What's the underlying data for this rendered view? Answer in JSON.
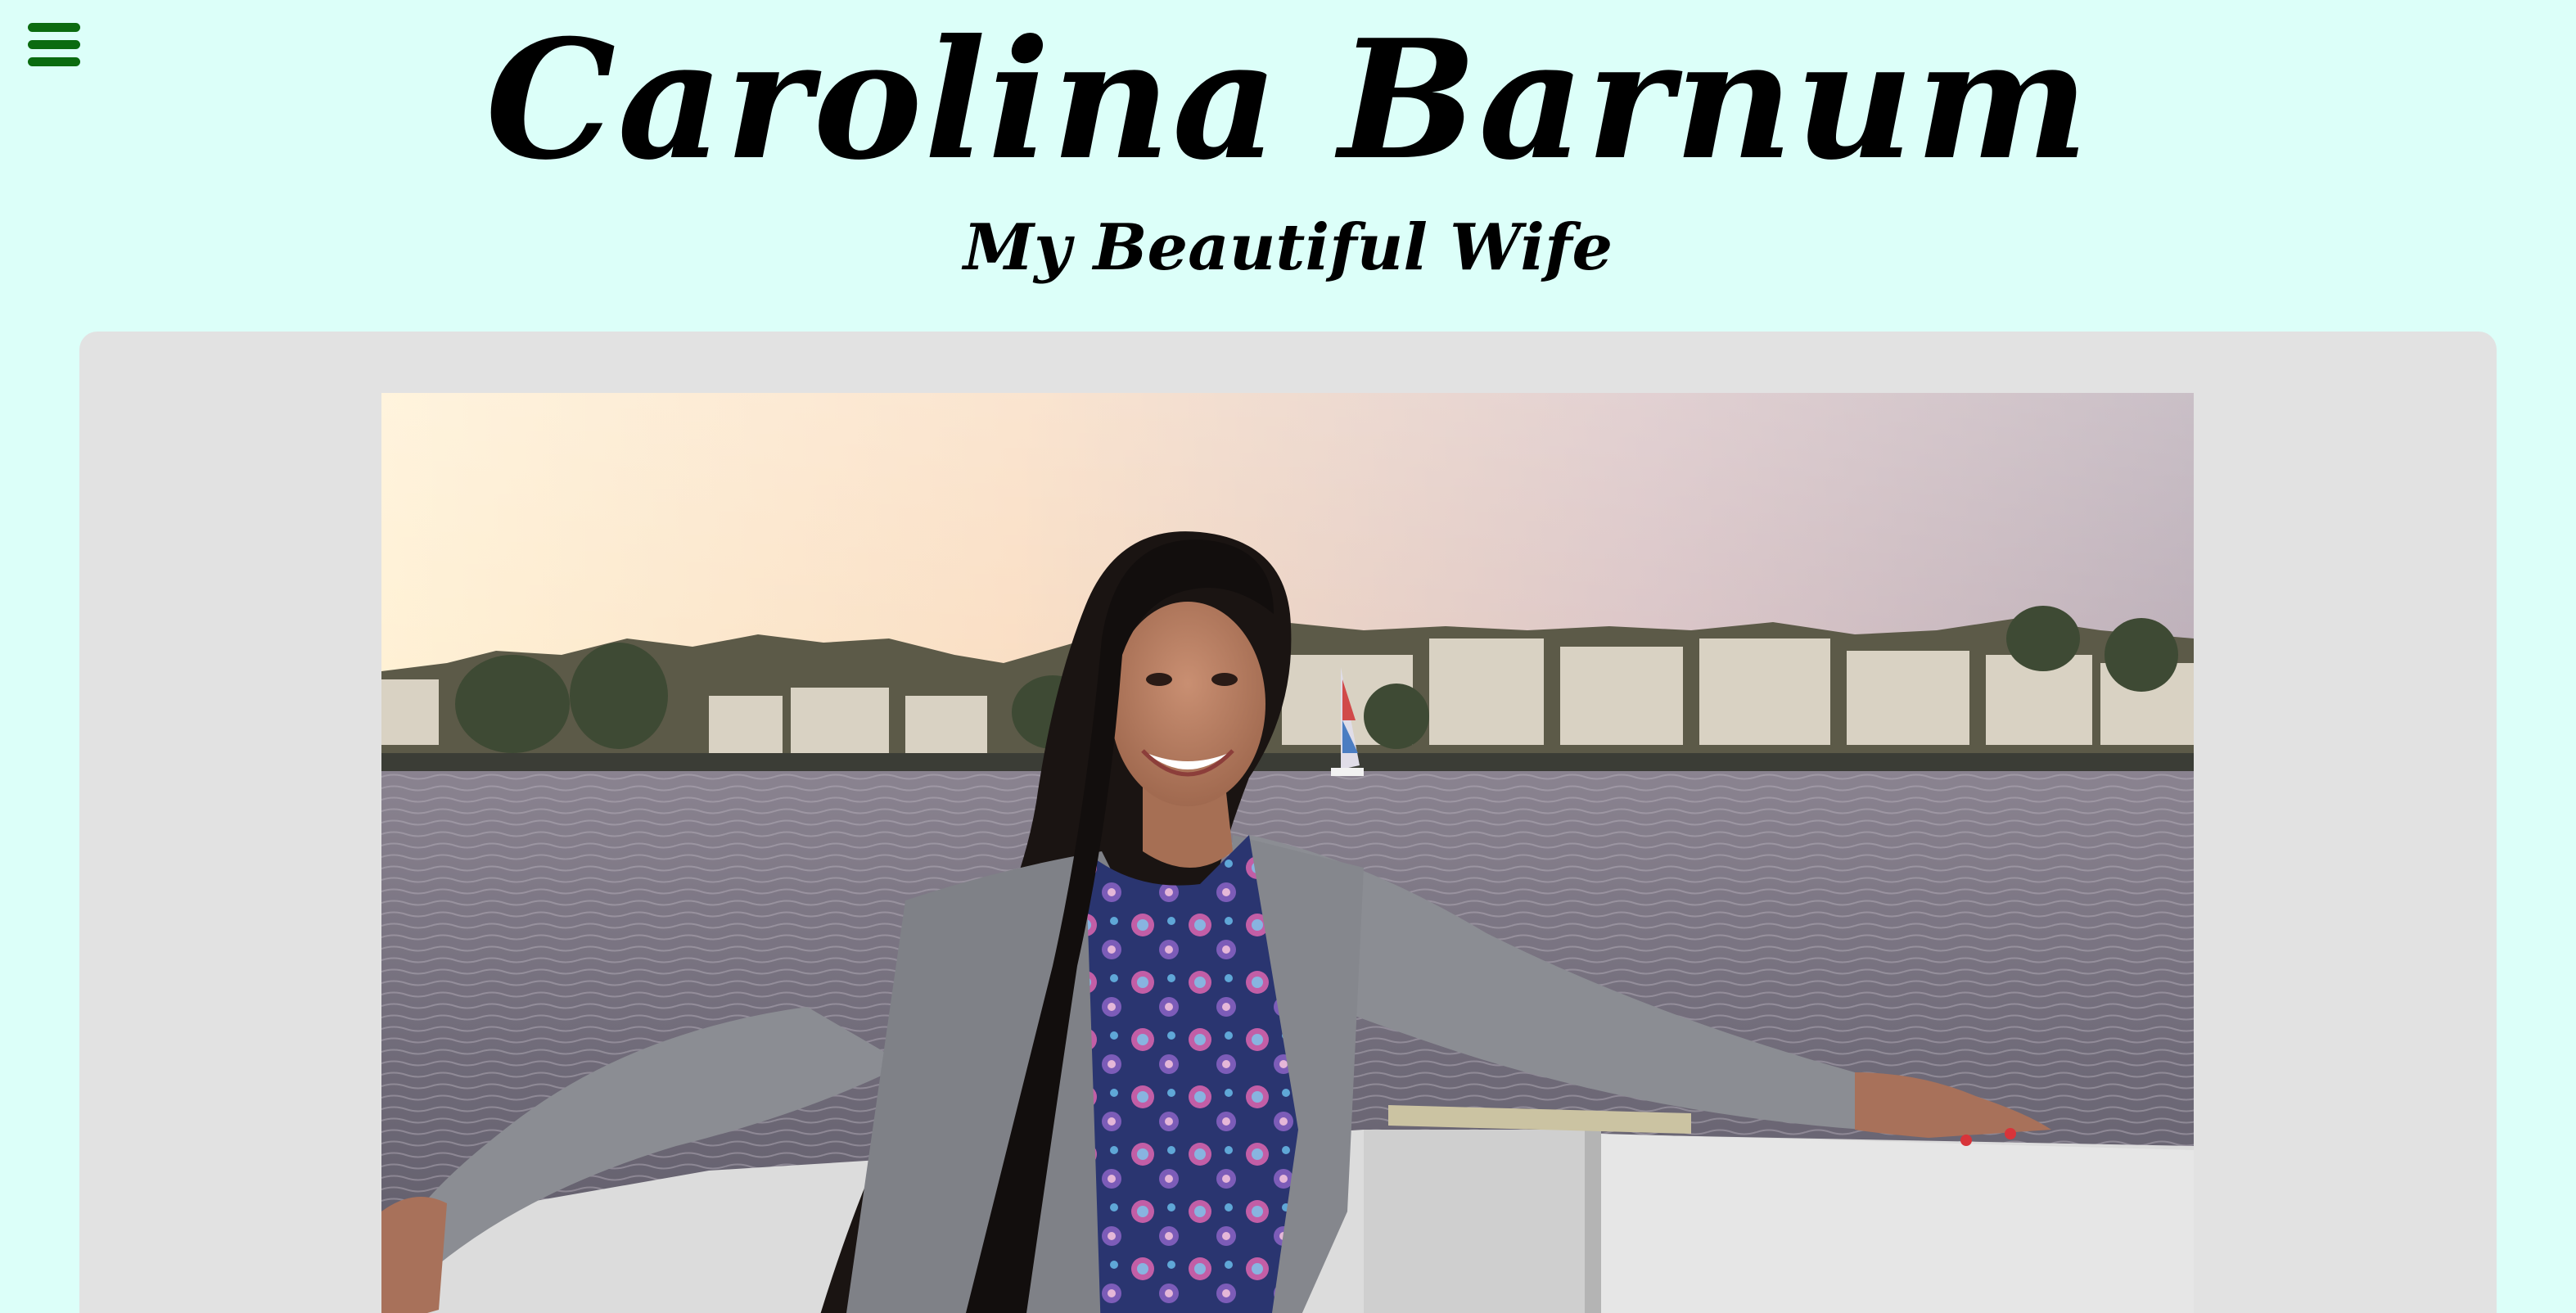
{
  "header": {
    "title": "Carolina Barnum",
    "subtitle": "My Beautiful Wife"
  },
  "menu": {
    "icon": "hamburger-menu-icon",
    "color": "#0b6b10"
  },
  "colors": {
    "background": "#dcfff9",
    "card": "#e2e2e2"
  },
  "main_photo": {
    "subject": "woman smiling on a boat at sunset on a lake"
  }
}
